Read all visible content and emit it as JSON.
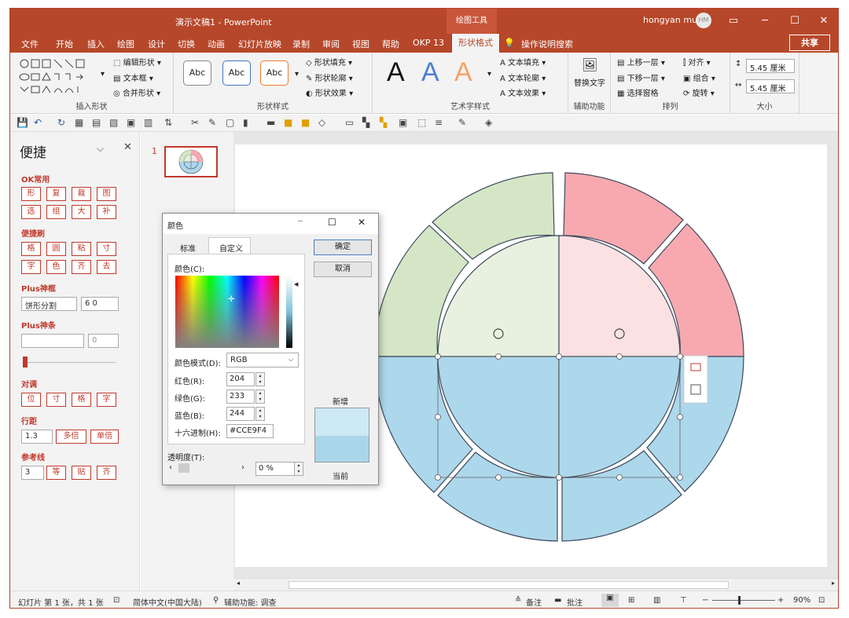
{
  "window": {
    "title": "演示文稿1 - PowerPoint",
    "context_tab": "绘图工具",
    "user": "hongyan mu",
    "avatar": "HM"
  },
  "tabs": [
    "文件",
    "开始",
    "插入",
    "绘图",
    "设计",
    "切换",
    "动画",
    "幻灯片放映",
    "录制",
    "审阅",
    "视图",
    "帮助",
    "OKP 13",
    "形状格式",
    "操作说明搜索"
  ],
  "share_label": "共享",
  "ribbon": {
    "insert_shapes": {
      "label": "插入形状",
      "edit_shape": "编辑形状",
      "textbox": "文本框",
      "merge": "合并形状"
    },
    "shape_styles": {
      "label": "形状样式",
      "samples": [
        "Abc",
        "Abc",
        "Abc"
      ],
      "fill": "形状填充",
      "outline": "形状轮廓",
      "effects": "形状效果"
    },
    "wordart": {
      "label": "艺术字样式",
      "samples": [
        "A",
        "A",
        "A"
      ],
      "text_fill": "文本填充",
      "text_outline": "文本轮廓",
      "text_effects": "文本效果"
    },
    "accessibility": {
      "label": "辅助功能",
      "alt_text": "替换文字"
    },
    "arrange": {
      "label": "排列",
      "forward": "上移一层",
      "backward": "下移一层",
      "selection_pane": "选择窗格",
      "align": "对齐",
      "group": "组合",
      "rotate": "旋转"
    },
    "size": {
      "label": "大小",
      "height": "5.45 厘米",
      "width": "5.45 厘米"
    }
  },
  "left_pane": {
    "title": "便捷",
    "sections": {
      "ok_common": {
        "label": "OK常用",
        "buttons": [
          "形",
          "复",
          "裁",
          "图",
          "选",
          "组",
          "大",
          "补"
        ]
      },
      "brush": {
        "label": "便捷刷",
        "buttons": [
          "格",
          "圆",
          "粘",
          "寸",
          "字",
          "色",
          "齐",
          "去"
        ]
      },
      "plus_frame": {
        "label": "Plus神框",
        "field1": "饼形分割",
        "field2": "6 0"
      },
      "plus_bar": {
        "label": "Plus神条",
        "field2": "0"
      },
      "adjust": {
        "label": "对调",
        "buttons": [
          "位",
          "寸",
          "格",
          "字"
        ]
      },
      "line_spacing": {
        "label": "行距",
        "value": "1.3",
        "btn1": "多倍",
        "btn2": "单倍"
      },
      "guides": {
        "label": "参考线",
        "value": "3",
        "buttons": [
          "等",
          "贴",
          "齐"
        ]
      }
    }
  },
  "thumbnail": {
    "number": "1"
  },
  "color_dialog": {
    "title": "颜色",
    "tabs": [
      "标准",
      "自定义"
    ],
    "ok": "确定",
    "cancel": "取消",
    "colors_label": "颜色(C):",
    "mode_label": "颜色模式(D):",
    "mode_value": "RGB",
    "red_label": "红色(R):",
    "red": "204",
    "green_label": "绿色(G):",
    "green": "233",
    "blue_label": "蓝色(B):",
    "blue": "244",
    "hex_label": "十六进制(H):",
    "hex": "#CCE9F4",
    "new_label": "新增",
    "current_label": "当前",
    "transparency_label": "透明度(T):",
    "transparency": "0 %",
    "new_color": "#CCE9F4",
    "current_color": "#A9D6EA"
  },
  "status": {
    "slide": "幻灯片 第 1 张，共 1 张",
    "lang": "简体中文(中国大陆)",
    "access": "辅助功能: 调查",
    "notes": "备注",
    "comments": "批注",
    "zoom": "90%"
  },
  "colors": {
    "accent": "#B7472A",
    "green_outer": "#D5E6C6",
    "pink_outer": "#F8A9B0",
    "blue": "#ADD7EB",
    "green_inner": "#E8F1DF",
    "pink_inner": "#FCE1E3"
  }
}
